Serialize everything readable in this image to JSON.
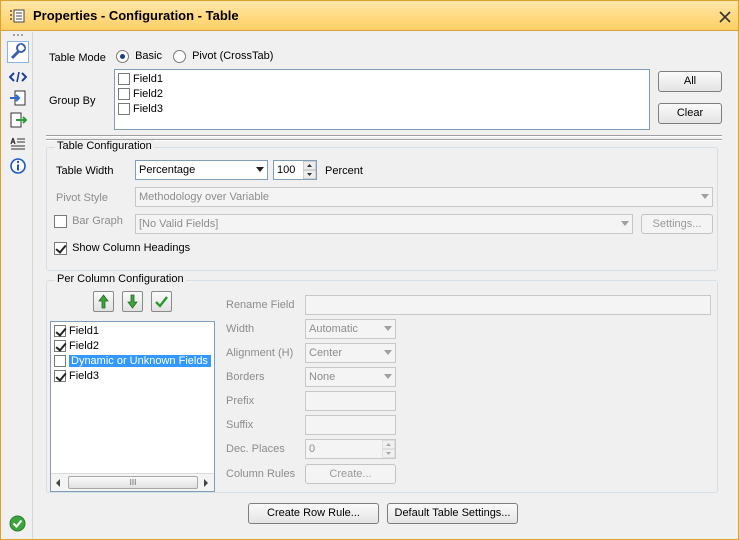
{
  "window": {
    "title": "Properties - Configuration - Table"
  },
  "toolstrip": {
    "items": [
      "wrench-icon",
      "xml-icon",
      "input-icon",
      "output-icon",
      "annotation-icon",
      "info-icon"
    ],
    "status_icon": "check-circle-icon"
  },
  "table_mode": {
    "label": "Table Mode",
    "options": [
      "Basic",
      "Pivot (CrossTab)"
    ],
    "selected": "Basic"
  },
  "group_by": {
    "label": "Group By",
    "fields": [
      "Field1",
      "Field2",
      "Field3"
    ],
    "all_button": "All",
    "clear_button": "Clear"
  },
  "table_config": {
    "title": "Table Configuration",
    "width_label": "Table Width",
    "width_mode": "Percentage",
    "width_value": "100",
    "width_unit": "Percent",
    "pivot_style_label": "Pivot Style",
    "pivot_style_value": "Methodology over Variable",
    "bar_graph_label": "Bar Graph",
    "bar_graph_value": "[No Valid Fields]",
    "settings_button": "Settings...",
    "show_headings_label": "Show Column Headings"
  },
  "per_column": {
    "title": "Per Column Configuration",
    "fields": [
      {
        "label": "Field1",
        "checked": true
      },
      {
        "label": "Field2",
        "checked": true
      },
      {
        "label": "Dynamic or Unknown Fields",
        "checked": false,
        "selected": true
      },
      {
        "label": "Field3",
        "checked": true
      }
    ],
    "scroll_thumb_glyph": "III",
    "rename_label": "Rename Field",
    "width_label": "Width",
    "width_value": "Automatic",
    "alignment_label": "Alignment (H)",
    "alignment_value": "Center",
    "borders_label": "Borders",
    "borders_value": "None",
    "prefix_label": "Prefix",
    "suffix_label": "Suffix",
    "dec_places_label": "Dec. Places",
    "dec_places_value": "0",
    "column_rules_label": "Column Rules",
    "create_button": "Create..."
  },
  "footer": {
    "create_row_rule": "Create Row Rule...",
    "default_settings": "Default Table Settings..."
  }
}
